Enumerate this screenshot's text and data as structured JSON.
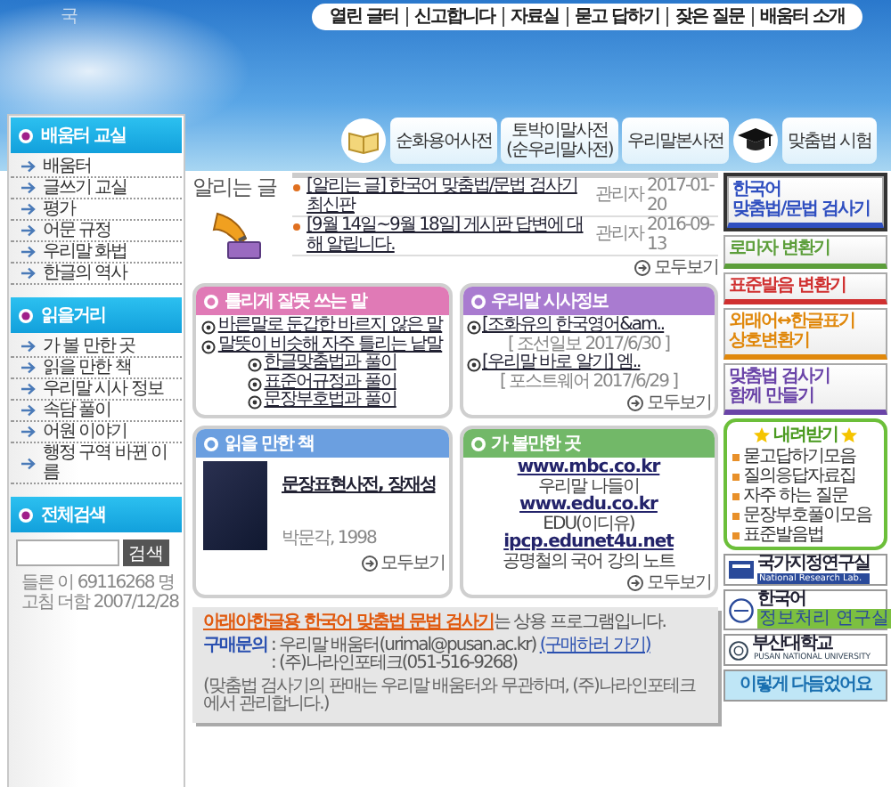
{
  "corner_mark": "국",
  "top_nav": [
    "열린 글터",
    "신고합니다",
    "자료실",
    "묻고 답하기",
    "잦은 질문",
    "배움터 소개"
  ],
  "dictionaries": [
    {
      "label": "순화용어사전"
    },
    {
      "label": "토박이말사전",
      "sub": "(순우리말사전)"
    },
    {
      "label": "우리말본사전"
    }
  ],
  "test_link": "맞춤법 시험",
  "sidebar": {
    "sections": [
      {
        "title": "배움터 교실",
        "items": [
          "배움터",
          "글쓰기 교실",
          "평가",
          "어문 규정",
          "우리말 화법",
          "한글의 역사"
        ]
      },
      {
        "title": "읽을거리",
        "items": [
          "가 볼 만한 곳",
          "읽을 만한 책",
          "우리말 시사 정보",
          "속담 풀이",
          "어원 이야기",
          "행정 구역 바뀐 이름"
        ]
      }
    ],
    "search": {
      "title": "전체검색",
      "button": "검색"
    },
    "visitors": "들른 이 69116268 명",
    "updated": "고침 더함 2007/12/28"
  },
  "notice": {
    "title": "알리는 글",
    "rows": [
      {
        "subject": "[알리는 글] 한국어 맞춤법/문법 검사기 최신판",
        "author": "관리자",
        "date": "2017-01-20"
      },
      {
        "subject": "[9월 14일~9월 18일] 게시판 답변에 대해 알립니다.",
        "author": "관리자",
        "date": "2016-09-13"
      }
    ],
    "more": "모두보기"
  },
  "boxes": [
    {
      "kind": "links",
      "title": "틀리게 잘못 쓰는 말",
      "color": "#e07ab6",
      "links": [
        "바른말로 둔갑한 바르지 않은 말",
        "말뜻이 비슷해 자주 틀리는 낱말",
        "한글맞춤법과 풀이",
        "표준어규정과 풀이",
        "문장부호법과 풀이"
      ]
    },
    {
      "kind": "news",
      "title": "우리말 시사정보",
      "color": "#a97bd0",
      "items": [
        {
          "link": "[조화유의 한국영어&am..",
          "source": "[ 조선일보 2017/6/30 ]"
        },
        {
          "link": "[우리말 바로 알기] 엠..",
          "source": "[ 포스트웨어 2017/6/29 ]"
        }
      ],
      "more": "모두보기"
    },
    {
      "kind": "book",
      "title": "읽을 만한 책",
      "color": "#6b9fe0",
      "book": "문장표현사전, 장재성",
      "publisher": "박문각, 1998",
      "more": "모두보기"
    },
    {
      "kind": "sites",
      "title": "가 볼만한 곳",
      "color": "#72b868",
      "lines": [
        {
          "text": "www.mbc.co.kr",
          "link": true
        },
        {
          "text": "우리말 나들이",
          "link": false
        },
        {
          "text": "www.edu.co.kr",
          "link": true
        },
        {
          "text": "EDU(이디유)",
          "link": false
        },
        {
          "text": "ipcp.edunet4u.net",
          "link": true
        },
        {
          "text": "공명철의 국어 강의 노트",
          "link": false
        }
      ],
      "more": "모두보기"
    }
  ],
  "purchase": {
    "headline_link": "아래아한글용 한국어 맞춤법 문법 검사기",
    "headline_rest": "는 상용 프로그램입니다.",
    "contact_label": "구매문의",
    "contact": ": 우리말 배움터(urimal@pusan.ac.kr)",
    "contact_link": "(구매하러 가기)",
    "contact_2": ": (주)나라인포테크(051-516-9268)",
    "note": "(맞춤법 검사기의 판매는 우리말 배움터와 무관하며, (주)나라인포테크에서 관리합니다.)"
  },
  "tools": [
    {
      "lines": [
        "한국어",
        "맞춤법/문법 검사기"
      ],
      "color": "#2f4fc0",
      "selected": true
    },
    {
      "lines": [
        "로마자 변환기"
      ],
      "color": "#5c9e3a",
      "selected": false
    },
    {
      "lines": [
        "표준발음 변환기"
      ],
      "color": "#d03030",
      "selected": false
    },
    {
      "lines": [
        "외래어↔한글표기",
        "상호변환기"
      ],
      "color": "#e0880c",
      "selected": false
    },
    {
      "lines": [
        "맞춤법 검사기",
        "함께 만들기"
      ],
      "color": "#6a44a8",
      "selected": false
    }
  ],
  "downloads": {
    "title": "내려받기",
    "items": [
      "묻고답하기모음",
      "질의응답자료집",
      "자주 하는 질문",
      "문장부호풀이모음",
      "표준발음법"
    ]
  },
  "logos": [
    {
      "kind": "lab",
      "text": "국가지정연구실",
      "sub": "National Research Lab."
    },
    {
      "kind": "klpl",
      "text": "한국어",
      "sub": "정보처리 연구실"
    },
    {
      "kind": "university",
      "text": "부산대학교",
      "sub": "PUSAN NATIONAL UNIVERSITY"
    },
    {
      "kind": "refined",
      "text": "이렇게 다듬었어요"
    }
  ]
}
